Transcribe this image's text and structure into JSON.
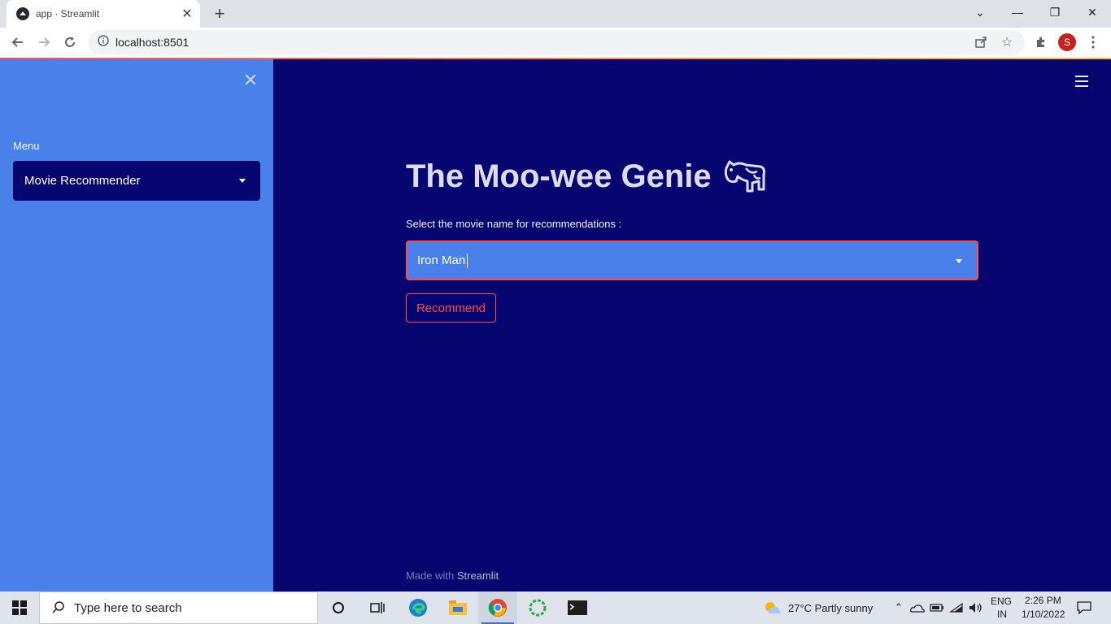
{
  "browser": {
    "tab_title": "app · Streamlit",
    "url": "localhost:8501",
    "profile_initial": "S"
  },
  "sidebar": {
    "menu_label": "Menu",
    "selected_page": "Movie Recommender"
  },
  "main": {
    "title": "The Moo-wee Genie",
    "select_label": "Select the movie name for recommendations :",
    "select_value": "Iron Man",
    "button_label": "Recommend",
    "footer_prefix": "Made with",
    "footer_link": "Streamlit"
  },
  "taskbar": {
    "search_placeholder": "Type here to search",
    "weather": "27°C  Partly sunny",
    "lang": "ENG",
    "region": "IN",
    "time": "2:26 PM",
    "date": "1/10/2022"
  },
  "colors": {
    "sidebar_bg": "#4a80ea",
    "main_bg": "#070670",
    "accent": "#ff4b4b"
  }
}
